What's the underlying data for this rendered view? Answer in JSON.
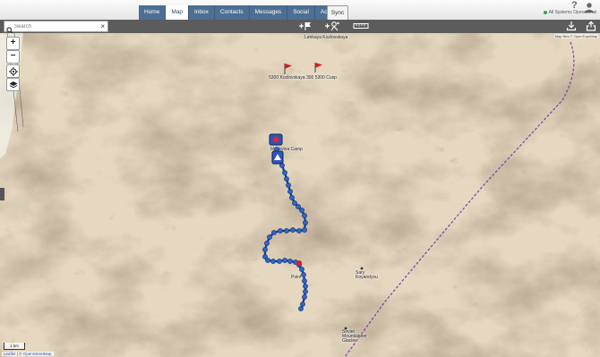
{
  "nav": {
    "tabs": [
      {
        "label": "Home"
      },
      {
        "label": "Map"
      },
      {
        "label": "Inbox"
      },
      {
        "label": "Contacts"
      },
      {
        "label": "Messages"
      },
      {
        "label": "Social"
      },
      {
        "label": "Account"
      }
    ],
    "active_tab": "Map",
    "sync_label": "Sync",
    "status_text": "All Systems Operational",
    "help_label": "?"
  },
  "toolbar": {
    "search_placeholder": "Search",
    "clear_label": "×"
  },
  "map": {
    "zoom_in_label": "+",
    "zoom_out_label": "−",
    "scale_label": "1 km",
    "attribution_leaflet": "Leaflet",
    "attribution_sep": " | © ",
    "attribution_osm": "OpenStreetMap",
    "attribution_tiles": "Map tiles © OpenTopoMap",
    "labels": {
      "top_peak": "Lenkaya Kozlovskaya",
      "flags_label": "5300 Kozlovskaya 300 5300 Cusp",
      "camp_label": "Moskvina Camp",
      "point_label": "Point",
      "pass_label": "Sary Koyandysu",
      "lake_label": "Soviet Mountaineer Glacier"
    },
    "colors": {
      "track": "#2e66c9",
      "track_dark": "#1a3f8a",
      "flag": "#d61f1f",
      "route": "#7b3fa6"
    }
  }
}
